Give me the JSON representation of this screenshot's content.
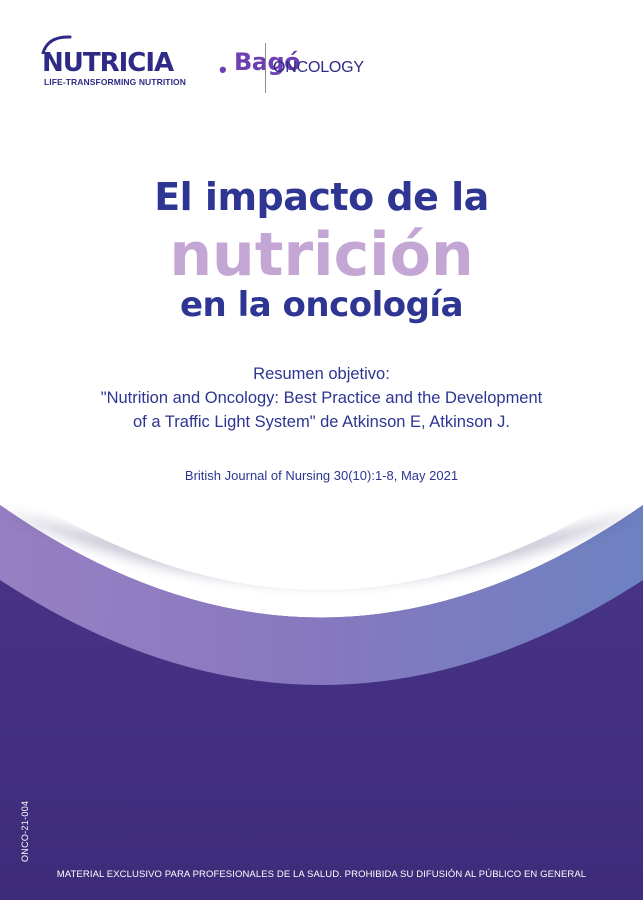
{
  "logo": {
    "brand_primary": "NUTRICIA",
    "tagline": "LIFE-TRANSFORMING NUTRITION",
    "separator": "•",
    "brand_secondary": "Bagó",
    "division": "ONCOLOGY"
  },
  "title": {
    "line1": "El impacto de la",
    "line2": "nutrición",
    "line3": "en la oncología"
  },
  "summary": {
    "label": "Resumen objetivo:",
    "line1": "\"Nutrition and Oncology: Best Practice and the Development",
    "line2": "of a Traffic Light System\" de Atkinson E, Atkinson J."
  },
  "citation": "British Journal of Nursing 30(10):1-8, May 2021",
  "footer": {
    "doc_code": "ONCO-21-004",
    "disclaimer": "MATERIAL EXCLUSIVO PARA PROFESIONALES DE LA SALUD. PROHIBIDA SU DIFUSIÓN AL PÚBLICO EN GENERAL"
  },
  "colors": {
    "navy": "#2e3592",
    "lilac": "#c4a6d5",
    "purple_band": "#42307f",
    "bago_purple": "#6d3fb0"
  }
}
